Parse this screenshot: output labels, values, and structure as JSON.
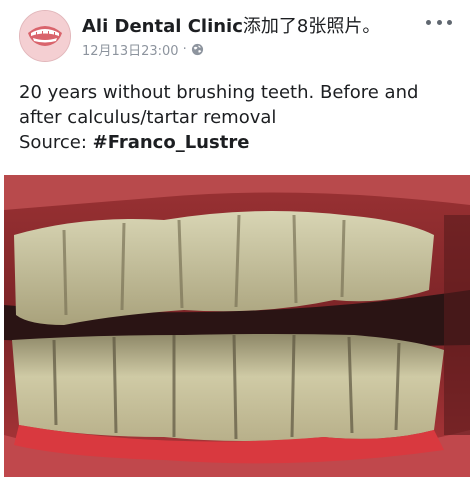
{
  "post": {
    "page_name": "Ali Dental Clinic",
    "action_text": "添加了8张照片。",
    "timestamp": "12月13日23:00",
    "separator": "·",
    "privacy_icon": "globe-icon",
    "more_icon": "more-options-icon",
    "body_line1": "20 years without brushing teeth. Before and",
    "body_line2": "after calculus/tartar removal",
    "source_label": "Source: ",
    "hashtag": "#Franco_Lustre"
  },
  "photo": {
    "subject": "teeth-with-tartar",
    "colors": {
      "gum": "#c3454a",
      "lip": "#a8322f",
      "tartar": "#cdc9a4",
      "dark": "#2a1414"
    }
  }
}
